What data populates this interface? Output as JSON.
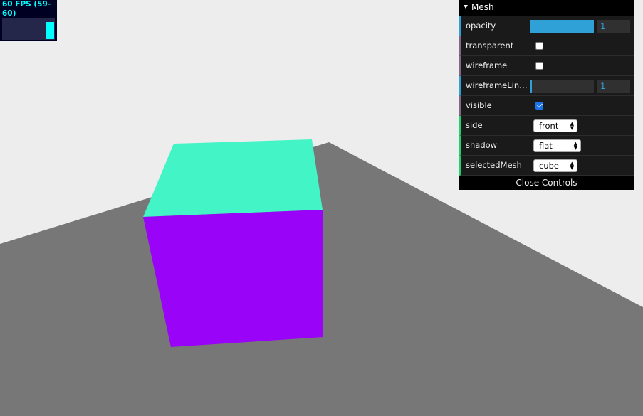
{
  "stats": {
    "fps_text": "60 FPS (59-60)",
    "fps_level": 0.8
  },
  "scene": {
    "background": "#ededed",
    "plane_color": "#777777",
    "cube_top_color": "#43f4c6",
    "cube_front_color": "#9903f7"
  },
  "gui": {
    "folder_title": "Mesh",
    "controllers": [
      {
        "label": "opacity",
        "type": "number",
        "value": "1",
        "fraction": 1
      },
      {
        "label": "transparent",
        "type": "boolean",
        "checked": false
      },
      {
        "label": "wireframe",
        "type": "boolean",
        "checked": false
      },
      {
        "label": "wireframeLin…",
        "type": "number",
        "value": "1",
        "fraction": 0.02
      },
      {
        "label": "visible",
        "type": "boolean",
        "checked": true
      },
      {
        "label": "side",
        "type": "select",
        "value": "front"
      },
      {
        "label": "shadow",
        "type": "select",
        "value": "flat"
      },
      {
        "label": "selectedMesh",
        "type": "select",
        "value": "cube"
      }
    ],
    "close_label": "Close Controls",
    "colors": {
      "number": "#2fa1d6",
      "boolean": "#806787",
      "string": "#1ed36f"
    }
  }
}
